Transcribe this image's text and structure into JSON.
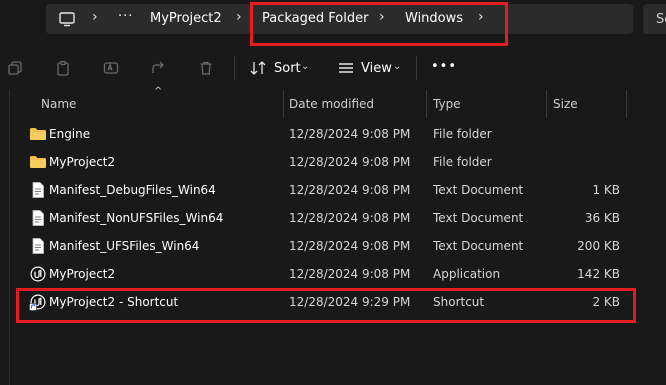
{
  "address": {
    "crumbs": [
      "MyProject2",
      "Packaged Folder",
      "Windows"
    ],
    "more_label": "···"
  },
  "search": {
    "placeholder": "Se"
  },
  "toolbar": {
    "sort_label": "Sort",
    "view_label": "View",
    "more_label": "•••"
  },
  "columns": {
    "name": "Name",
    "date": "Date modified",
    "type": "Type",
    "size": "Size"
  },
  "files": [
    {
      "name": "Engine",
      "date": "12/28/2024 9:08 PM",
      "type": "File folder",
      "size": "",
      "icon": "folder-icon"
    },
    {
      "name": "MyProject2",
      "date": "12/28/2024 9:08 PM",
      "type": "File folder",
      "size": "",
      "icon": "folder-icon"
    },
    {
      "name": "Manifest_DebugFiles_Win64",
      "date": "12/28/2024 9:08 PM",
      "type": "Text Document",
      "size": "1 KB",
      "icon": "text-document-icon"
    },
    {
      "name": "Manifest_NonUFSFiles_Win64",
      "date": "12/28/2024 9:08 PM",
      "type": "Text Document",
      "size": "36 KB",
      "icon": "text-document-icon"
    },
    {
      "name": "Manifest_UFSFiles_Win64",
      "date": "12/28/2024 9:08 PM",
      "type": "Text Document",
      "size": "200 KB",
      "icon": "text-document-icon"
    },
    {
      "name": "MyProject2",
      "date": "12/28/2024 9:08 PM",
      "type": "Application",
      "size": "142 KB",
      "icon": "unreal-app-icon"
    },
    {
      "name": "MyProject2 - Shortcut",
      "date": "12/28/2024 9:29 PM",
      "type": "Shortcut",
      "size": "2 KB",
      "icon": "unreal-shortcut-icon"
    }
  ],
  "colors": {
    "highlight": "#e51c23",
    "folder": "#f0c24b",
    "background": "#191919"
  }
}
